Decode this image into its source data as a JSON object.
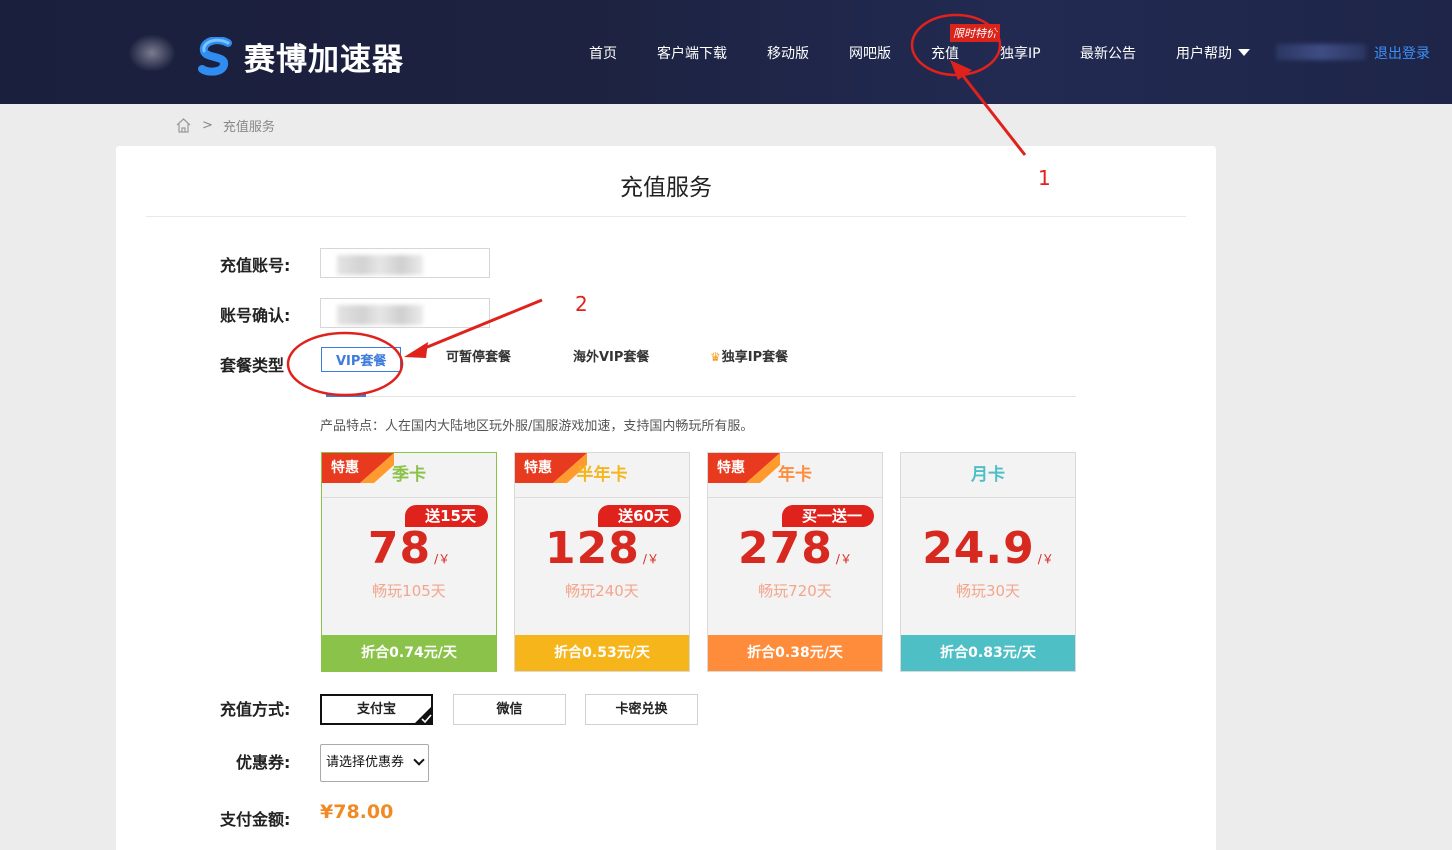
{
  "header": {
    "brand": "赛博加速器",
    "promo_tag": "限时特价",
    "nav": [
      {
        "label": "首页"
      },
      {
        "label": "客户端下载"
      },
      {
        "label": "移动版"
      },
      {
        "label": "网吧版"
      },
      {
        "label": "充值"
      },
      {
        "label": "独享IP"
      },
      {
        "label": "最新公告"
      },
      {
        "label": "用户帮助"
      }
    ],
    "logout": "退出登录"
  },
  "breadcrumb": {
    "current": "充值服务",
    "separator": ">"
  },
  "page": {
    "title": "充值服务",
    "account_label": "充值账号:",
    "confirm_label": "账号确认:",
    "plan_type_label": "套餐类型",
    "tabs": [
      {
        "label": "VIP套餐"
      },
      {
        "label": "可暂停套餐"
      },
      {
        "label": "海外VIP套餐"
      },
      {
        "label": "独享IP套餐"
      }
    ],
    "feature_text": "产品特点：人在国内大陆地区玩外服/国服游戏加速，支持国内畅玩所有服。",
    "plans": [
      {
        "ribbon": "特惠",
        "title": "季卡",
        "bonus": "送15天",
        "price": "78",
        "unit": "/￥",
        "days": "畅玩105天",
        "footer": "折合0.74元/天",
        "color": "#8bc34a",
        "title_color": "#8bc34a"
      },
      {
        "ribbon": "特惠",
        "title": "半年卡",
        "bonus": "送60天",
        "price": "128",
        "unit": "/￥",
        "days": "畅玩240天",
        "footer": "折合0.53元/天",
        "color": "#f5b51b",
        "title_color": "#f5b51b"
      },
      {
        "ribbon": "特惠",
        "title": "年卡",
        "bonus": "买一送一",
        "price": "278",
        "unit": "/￥",
        "days": "畅玩720天",
        "footer": "折合0.38元/天",
        "color": "#ff8c3a",
        "title_color": "#ff8c3a"
      },
      {
        "ribbon": "",
        "title": "月卡",
        "bonus": "",
        "price": "24.9",
        "unit": "/￥",
        "days": "畅玩30天",
        "footer": "折合0.83元/天",
        "color": "#4fbfc6",
        "title_color": "#4fbfc6"
      }
    ],
    "pay_label": "充值方式:",
    "pay_methods": [
      {
        "label": "支付宝"
      },
      {
        "label": "微信"
      },
      {
        "label": "卡密兑换"
      }
    ],
    "coupon_label": "优惠券:",
    "coupon_select": "请选择优惠券",
    "amount_label": "支付金额:",
    "amount": "¥78.00"
  },
  "annotations": {
    "num1": "1",
    "num2": "2"
  },
  "colors": {
    "header_bg": "#1d2240",
    "accent_blue": "#3e7cdc",
    "price_red": "#d7291f",
    "annotation_red": "#e0221c"
  }
}
